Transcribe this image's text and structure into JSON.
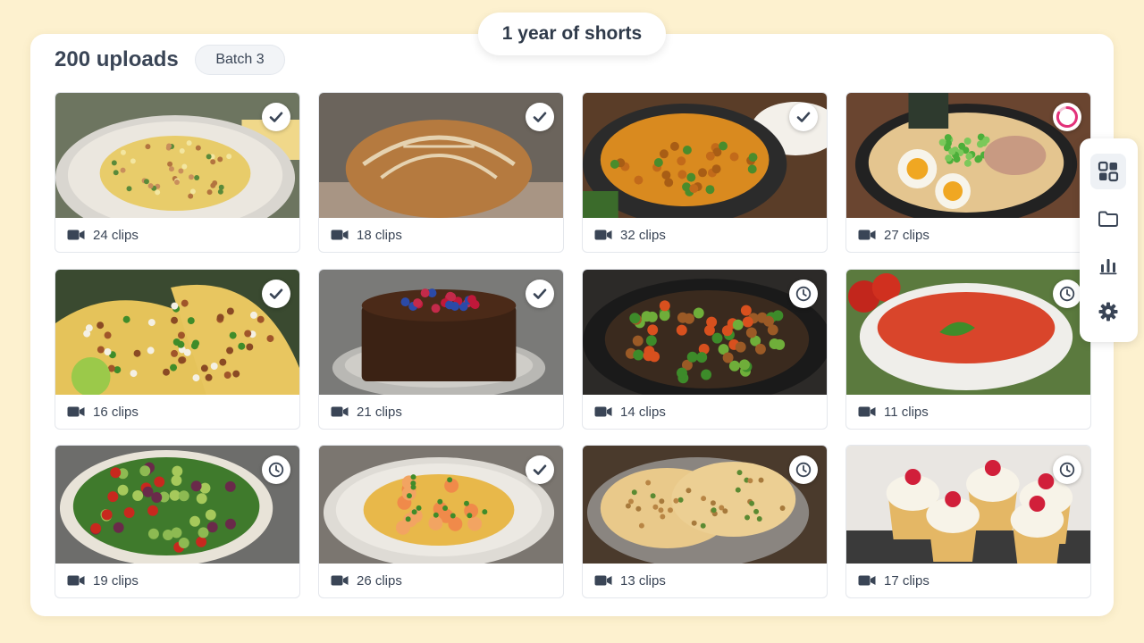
{
  "header": {
    "top_title": "1 year of shorts",
    "uploads": "200 uploads",
    "batch": "Batch 3"
  },
  "colors": {
    "background": "#fdf1cf",
    "badge_icon": "#3a4556",
    "progress_ring": "#e2327a"
  },
  "cards": [
    {
      "dish": "spaghetti carbonara",
      "clips": "24 clips",
      "status": "done"
    },
    {
      "dish": "sourdough bread",
      "clips": "18 clips",
      "status": "done"
    },
    {
      "dish": "chicken curry",
      "clips": "32 clips",
      "status": "done"
    },
    {
      "dish": "ramen",
      "clips": "27 clips",
      "status": "in-progress"
    },
    {
      "dish": "tacos",
      "clips": "16 clips",
      "status": "done"
    },
    {
      "dish": "chocolate cake",
      "clips": "21 clips",
      "status": "done"
    },
    {
      "dish": "stir fry",
      "clips": "14 clips",
      "status": "queued"
    },
    {
      "dish": "tomato soup",
      "clips": "11 clips",
      "status": "queued"
    },
    {
      "dish": "salad",
      "clips": "19 clips",
      "status": "queued"
    },
    {
      "dish": "shrimp pasta",
      "clips": "26 clips",
      "status": "done"
    },
    {
      "dish": "naan bread",
      "clips": "13 clips",
      "status": "queued"
    },
    {
      "dish": "raspberry cupcakes",
      "clips": "17 clips",
      "status": "queued"
    }
  ],
  "sidebar": [
    {
      "icon": "grid-icon",
      "active": true
    },
    {
      "icon": "folder-icon",
      "active": false
    },
    {
      "icon": "bar-chart-icon",
      "active": false
    },
    {
      "icon": "gear-icon",
      "active": false
    }
  ]
}
